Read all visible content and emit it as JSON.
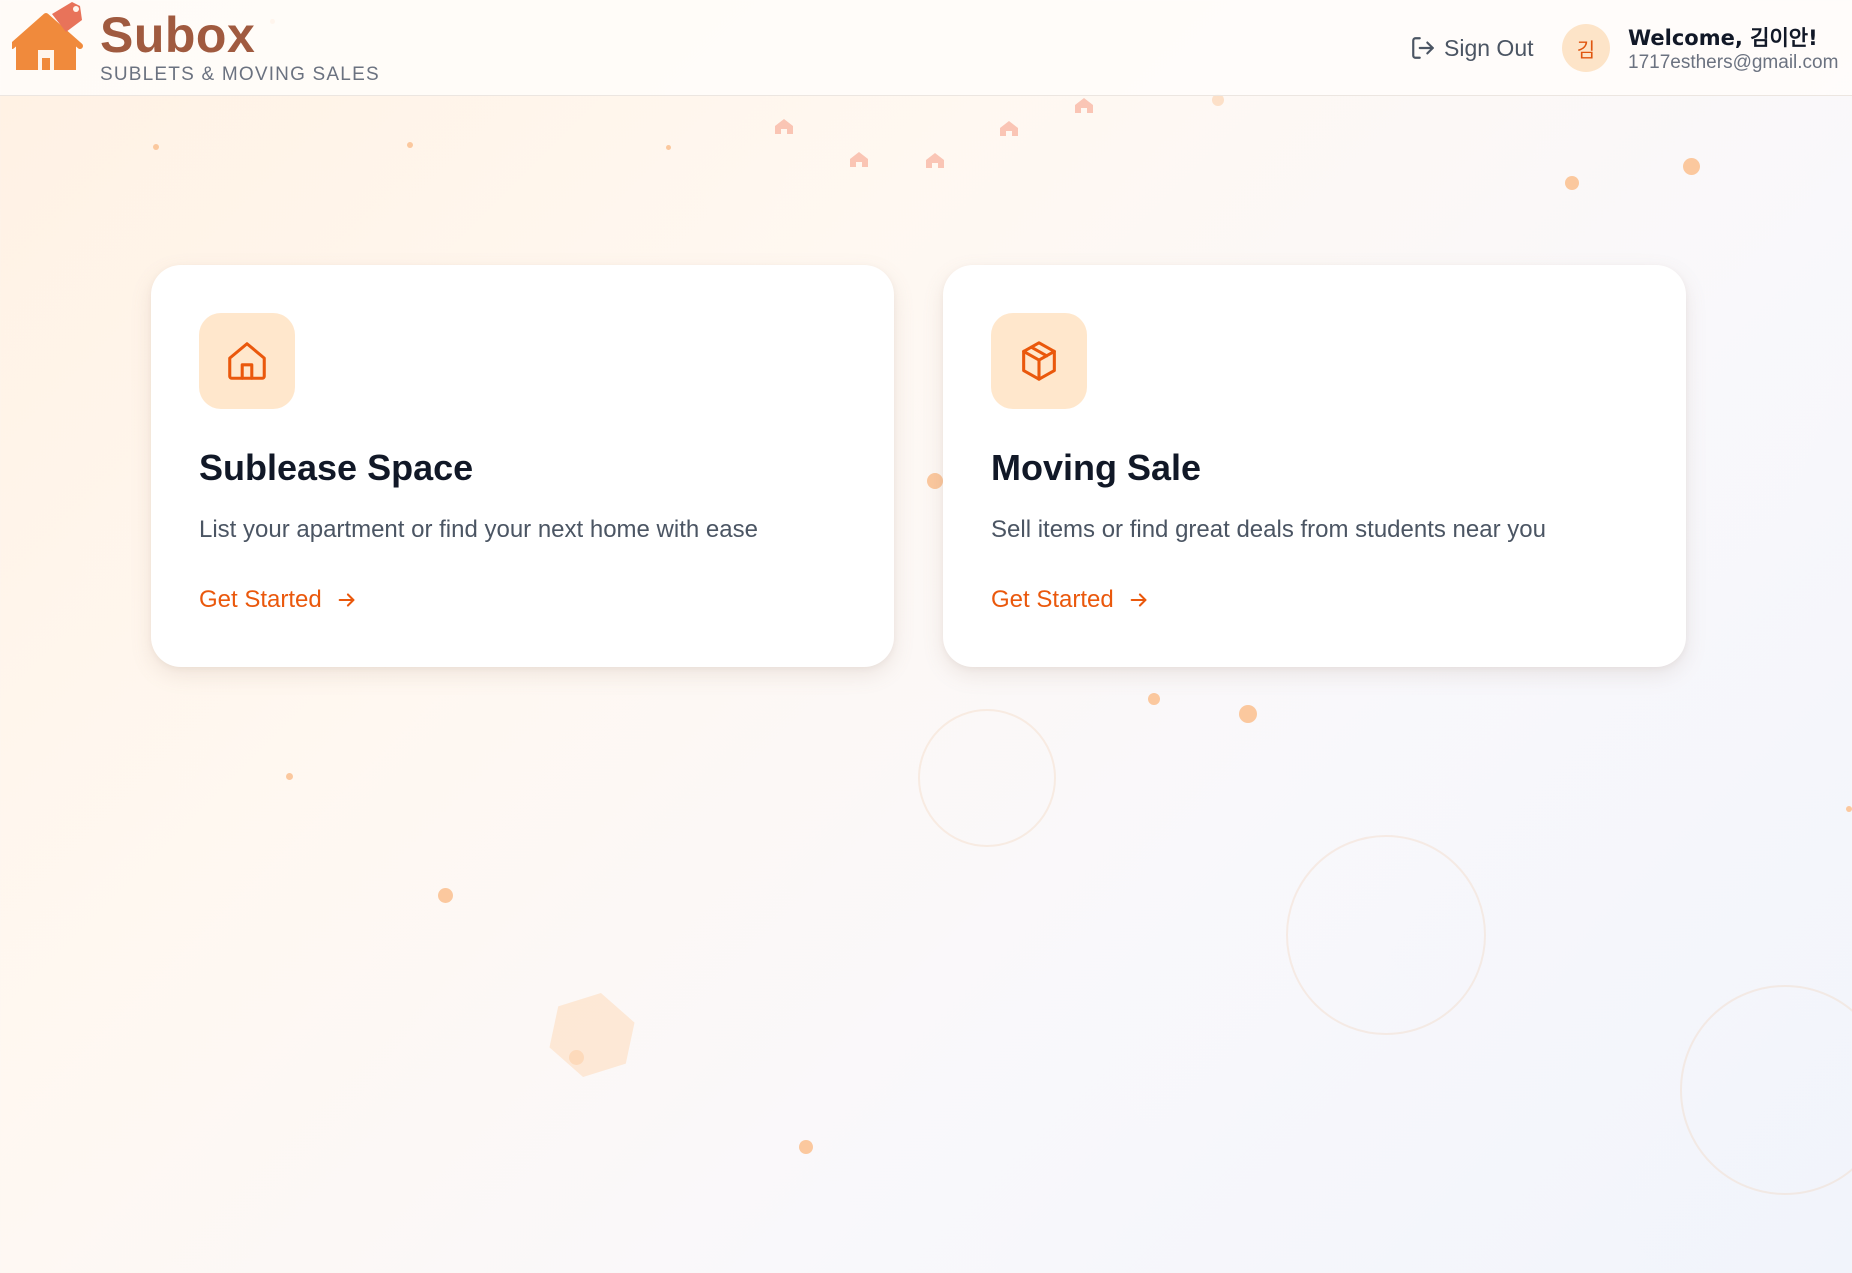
{
  "header": {
    "brand_name": "Subox",
    "tagline": "SUBLETS & MOVING SALES",
    "sign_out_label": "Sign Out",
    "user": {
      "avatar_initial": "김",
      "welcome": "Welcome, 김이안!",
      "email": "1717esthers@gmail.com"
    }
  },
  "cards": [
    {
      "icon": "house-icon",
      "title": "Sublease Space",
      "description": "List your apartment or find your next home with ease",
      "cta": "Get Started"
    },
    {
      "icon": "box-icon",
      "title": "Moving Sale",
      "description": "Sell items or find great deals from students near you",
      "cta": "Get Started"
    }
  ],
  "icons": {
    "logo": "house-tag-logo-icon",
    "sign_out": "sign-out-icon",
    "cta_arrow": "arrow-right-icon"
  },
  "colors": {
    "brand": "#a05a3f",
    "accent": "#ea580c",
    "icon_tile": "#ffe7cc",
    "logo_orange": "#f08a3c",
    "logo_tag": "#e8735a"
  }
}
